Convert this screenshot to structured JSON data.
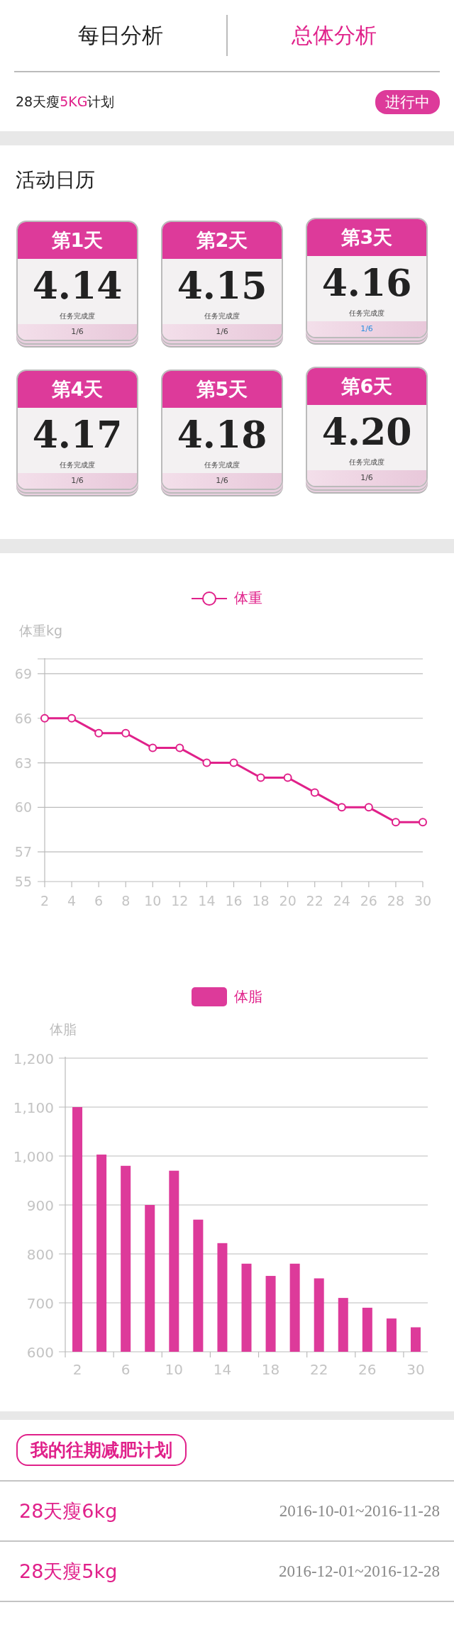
{
  "tabs": [
    {
      "label": "每日分析",
      "selected": false
    },
    {
      "label": "总体分析",
      "selected": true
    }
  ],
  "current_plan": {
    "prefix": "28天瘦",
    "highlight": "5KG",
    "suffix": "计划",
    "status": "进行中"
  },
  "calendar": {
    "title": "活动日历",
    "days": [
      {
        "label": "第1天",
        "date": "4.14",
        "progress_label": "任务完成度",
        "progress": "1/6",
        "selected": false
      },
      {
        "label": "第2天",
        "date": "4.15",
        "progress_label": "任务完成度",
        "progress": "1/6",
        "selected": false
      },
      {
        "label": "第3天",
        "date": "4.16",
        "progress_label": "任务完成度",
        "progress": "1/6",
        "selected": true
      },
      {
        "label": "第4天",
        "date": "4.17",
        "progress_label": "任务完成度",
        "progress": "1/6",
        "selected": false
      },
      {
        "label": "第5天",
        "date": "4.18",
        "progress_label": "任务完成度",
        "progress": "1/6",
        "selected": false
      },
      {
        "label": "第6天",
        "date": "4.20",
        "progress_label": "任务完成度",
        "progress": "1/6",
        "selected": false
      }
    ]
  },
  "weight_chart": {
    "chart_data": {
      "type": "line",
      "ylabel": "体重kg",
      "x": [
        2,
        4,
        6,
        8,
        10,
        12,
        14,
        16,
        18,
        20,
        22,
        24,
        26,
        28,
        30
      ],
      "series": [
        {
          "name": "体重",
          "color": "#e0218a",
          "values": [
            66,
            66,
            65,
            65,
            64,
            64,
            63,
            63,
            62,
            62,
            61,
            60,
            60,
            59,
            59
          ]
        }
      ],
      "xlim": [
        2,
        30
      ],
      "ylim": [
        55,
        70
      ],
      "yticks": [
        55,
        57,
        60,
        63,
        66,
        69
      ],
      "xticks": [
        2,
        4,
        6,
        8,
        10,
        12,
        14,
        16,
        18,
        20,
        22,
        24,
        26,
        28,
        30
      ],
      "grid": true,
      "marker": "circle"
    }
  },
  "fat_chart": {
    "chart_data": {
      "type": "bar",
      "ylabel": "体脂",
      "x": [
        2,
        4,
        6,
        8,
        10,
        12,
        14,
        16,
        18,
        20,
        22,
        24,
        26,
        28,
        30
      ],
      "series": [
        {
          "name": "体脂",
          "color": "#dd3a9a",
          "values": [
            1100,
            1003,
            980,
            900,
            970,
            870,
            822,
            780,
            755,
            780,
            750,
            710,
            690,
            668,
            650
          ]
        }
      ],
      "ylim": [
        600,
        1200
      ],
      "yticks": [
        {
          "value": 600,
          "label": "600"
        },
        {
          "value": 700,
          "label": "700"
        },
        {
          "value": 800,
          "label": "800"
        },
        {
          "value": 900,
          "label": "900"
        },
        {
          "value": 1000,
          "label": "1,000"
        },
        {
          "value": 1100,
          "label": "1,100"
        },
        {
          "value": 1200,
          "label": "1,200"
        }
      ],
      "xlim": [
        1,
        31
      ],
      "xticks": [
        2,
        6,
        10,
        14,
        18,
        22,
        26,
        30
      ],
      "grid": true
    }
  },
  "past_plans": {
    "title": "我的往期减肥计划",
    "items": [
      {
        "name": "28天瘦6kg",
        "dates": "2016-10-01~2016-11-28"
      },
      {
        "name": "28天瘦5kg",
        "dates": "2016-12-01~2016-12-28"
      }
    ]
  }
}
